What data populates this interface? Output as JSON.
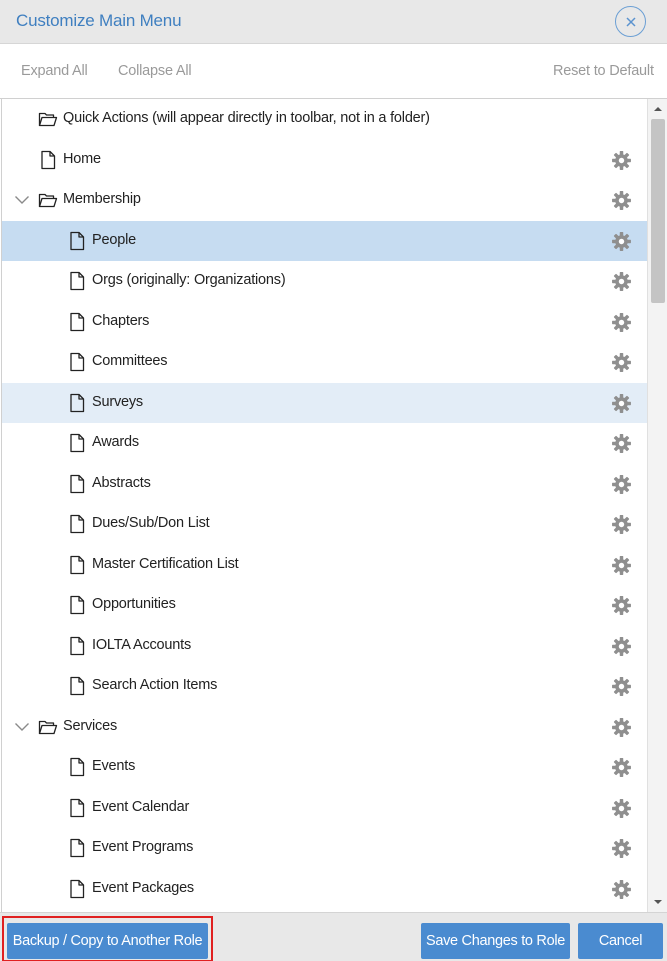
{
  "dialog": {
    "title": "Customize Main Menu"
  },
  "toolbar": {
    "expand_all": "Expand All",
    "collapse_all": "Collapse All",
    "reset": "Reset to Default"
  },
  "tree": {
    "items": [
      {
        "label": "Quick Actions (will appear directly in toolbar, not in a folder)",
        "type": "folder",
        "level": 0,
        "expandable": false,
        "gear": false,
        "state": "normal"
      },
      {
        "label": "Home",
        "type": "page",
        "level": 0,
        "expandable": false,
        "gear": true,
        "state": "normal"
      },
      {
        "label": "Membership",
        "type": "folder",
        "level": 0,
        "expandable": true,
        "gear": true,
        "state": "normal"
      },
      {
        "label": "People",
        "type": "page",
        "level": 1,
        "expandable": false,
        "gear": true,
        "state": "selected"
      },
      {
        "label": "Orgs (originally: Organizations)",
        "type": "page",
        "level": 1,
        "expandable": false,
        "gear": true,
        "state": "normal"
      },
      {
        "label": "Chapters",
        "type": "page",
        "level": 1,
        "expandable": false,
        "gear": true,
        "state": "normal"
      },
      {
        "label": "Committees",
        "type": "page",
        "level": 1,
        "expandable": false,
        "gear": true,
        "state": "normal"
      },
      {
        "label": "Surveys",
        "type": "page",
        "level": 1,
        "expandable": false,
        "gear": true,
        "state": "hover"
      },
      {
        "label": "Awards",
        "type": "page",
        "level": 1,
        "expandable": false,
        "gear": true,
        "state": "normal"
      },
      {
        "label": "Abstracts",
        "type": "page",
        "level": 1,
        "expandable": false,
        "gear": true,
        "state": "normal"
      },
      {
        "label": "Dues/Sub/Don List",
        "type": "page",
        "level": 1,
        "expandable": false,
        "gear": true,
        "state": "normal"
      },
      {
        "label": "Master Certification List",
        "type": "page",
        "level": 1,
        "expandable": false,
        "gear": true,
        "state": "normal"
      },
      {
        "label": "Opportunities",
        "type": "page",
        "level": 1,
        "expandable": false,
        "gear": true,
        "state": "normal"
      },
      {
        "label": "IOLTA Accounts",
        "type": "page",
        "level": 1,
        "expandable": false,
        "gear": true,
        "state": "normal"
      },
      {
        "label": "Search Action Items",
        "type": "page",
        "level": 1,
        "expandable": false,
        "gear": true,
        "state": "normal"
      },
      {
        "label": "Services",
        "type": "folder",
        "level": 0,
        "expandable": true,
        "gear": true,
        "state": "normal"
      },
      {
        "label": "Events",
        "type": "page",
        "level": 1,
        "expandable": false,
        "gear": true,
        "state": "normal"
      },
      {
        "label": "Event Calendar",
        "type": "page",
        "level": 1,
        "expandable": false,
        "gear": true,
        "state": "normal"
      },
      {
        "label": "Event Programs",
        "type": "page",
        "level": 1,
        "expandable": false,
        "gear": true,
        "state": "normal"
      },
      {
        "label": "Event Packages",
        "type": "page",
        "level": 1,
        "expandable": false,
        "gear": true,
        "state": "normal"
      }
    ]
  },
  "footer": {
    "backup": "Backup / Copy to Another Role",
    "save": "Save Changes to Role",
    "cancel": "Cancel"
  },
  "colors": {
    "accent": "#4a8bd0",
    "title": "#3f7fc0",
    "selected_row": "#c6dcf1",
    "hover_row": "#e3edf7",
    "highlight_border": "#e02020"
  }
}
